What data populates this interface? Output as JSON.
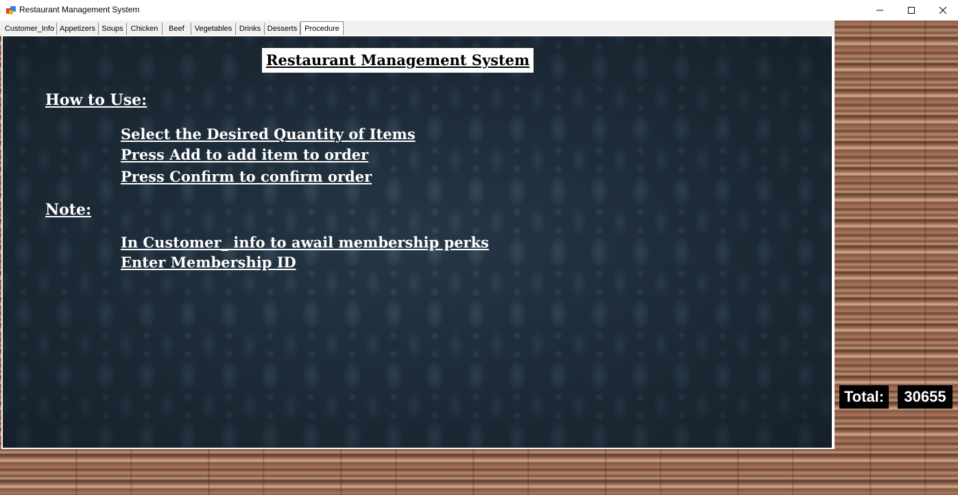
{
  "window": {
    "title": "Restaurant Management System",
    "icon": "app-icon",
    "controls": [
      "minimize-icon",
      "maximize-icon",
      "close-icon"
    ]
  },
  "tabs": [
    {
      "label": "Customer_Info"
    },
    {
      "label": "Appetizers"
    },
    {
      "label": "Soups"
    },
    {
      "label": "Chicken"
    },
    {
      "label": "Beef"
    },
    {
      "label": "Vegetables"
    },
    {
      "label": "Drinks"
    },
    {
      "label": "Desserts"
    },
    {
      "label": "Procedure",
      "active": true
    }
  ],
  "procedure": {
    "title": "Restaurant  Management System",
    "how_to_use_heading": "How to Use:",
    "steps": [
      "Select the Desired Quantity of Items",
      "Press Add to add item to order",
      "Press Confirm to confirm order"
    ],
    "note_heading": "Note:",
    "notes": [
      "In Customer_ info to awail membership perks",
      "Enter Membership ID"
    ]
  },
  "total": {
    "label": "Total:",
    "value": "30655"
  },
  "colors": {
    "panel_bg": "#22313f",
    "text": "#ffffff",
    "total_bg": "#000000"
  }
}
